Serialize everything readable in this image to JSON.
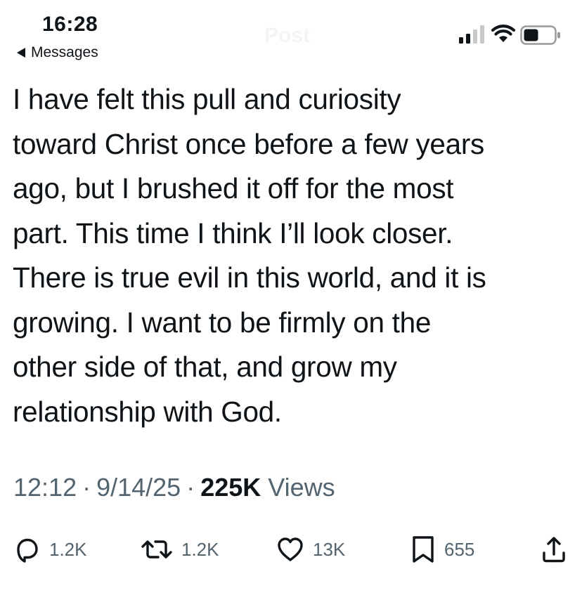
{
  "status_bar": {
    "time": "16:28",
    "back_label": "Messages",
    "ghost_title": "Post"
  },
  "post": {
    "lines": [
      "I have felt this pull and curiosity",
      "toward Christ once before a few years",
      "ago, but I brushed it off for the most",
      "part. This time I think I’ll look closer.",
      "There is true evil in this world, and it is",
      "growing. I want to be firmly on the",
      "other side of that, and grow my",
      "relationship with God."
    ],
    "time": "12:12",
    "date": "9/14/25",
    "views_count": "225K",
    "views_label": "Views"
  },
  "actions": {
    "replies": "1.2K",
    "reposts": "1.2K",
    "likes": "13K",
    "bookmarks": "655"
  },
  "colors": {
    "text": "#0f1419",
    "secondary": "#536471"
  },
  "icons": [
    "signal-icon",
    "wifi-icon",
    "battery-icon",
    "back-arrow-icon",
    "reply-icon",
    "repost-icon",
    "like-icon",
    "bookmark-icon",
    "share-icon"
  ]
}
